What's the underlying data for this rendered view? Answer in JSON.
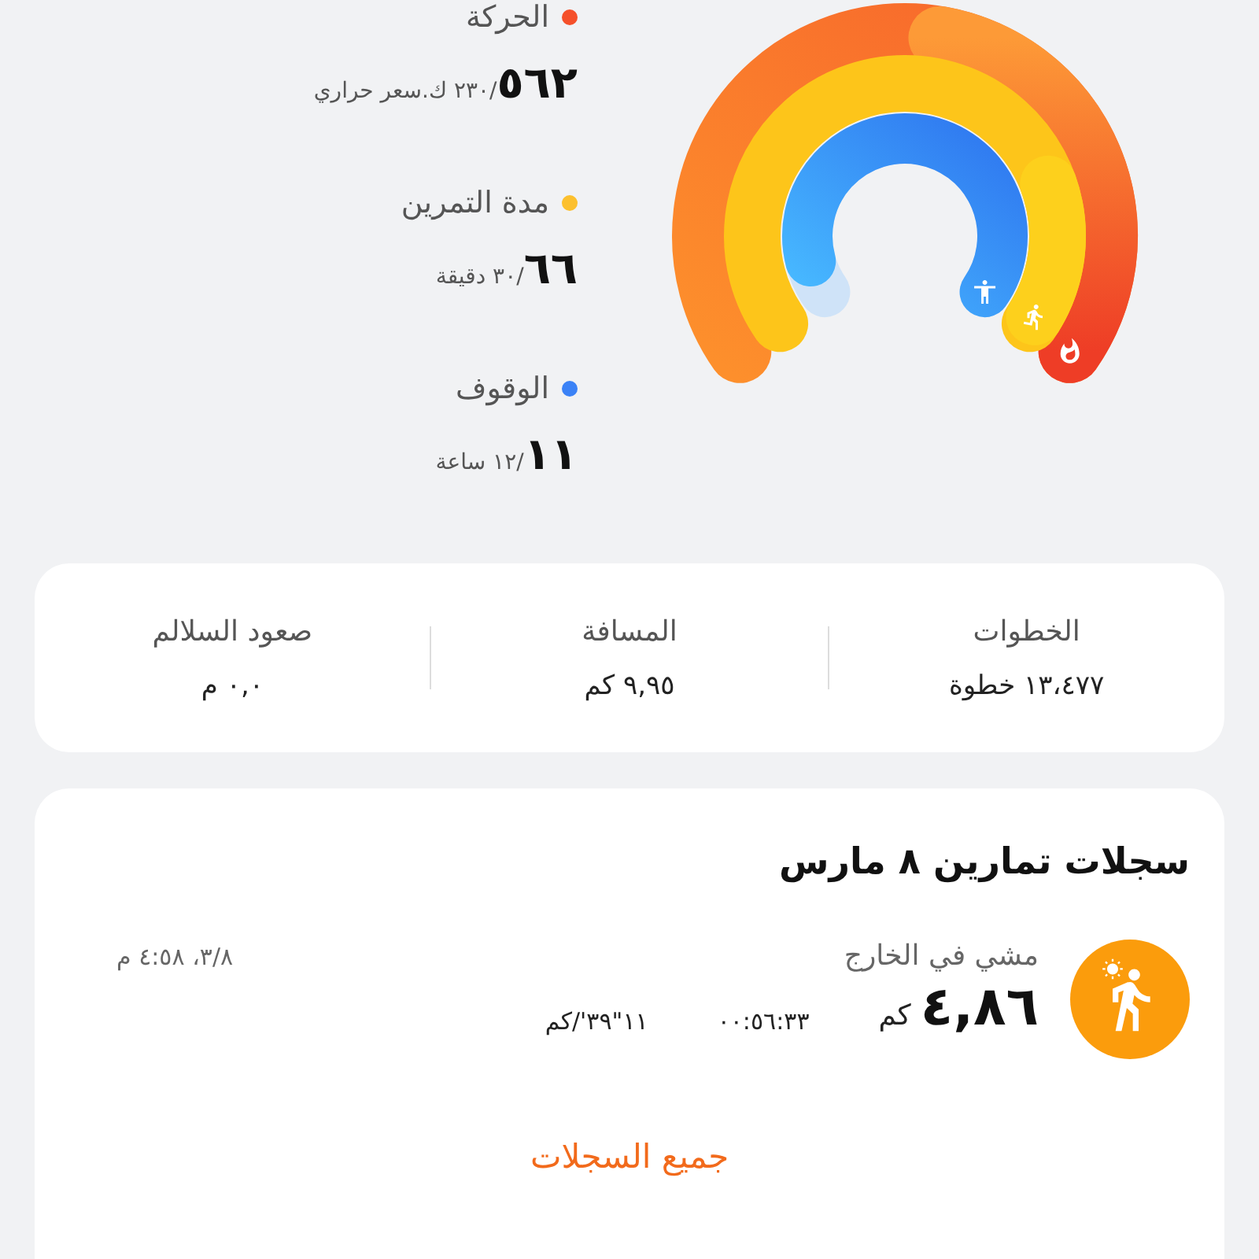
{
  "activity": [
    {
      "label": "الحركة",
      "color": "#f5502a",
      "value": "٥٦٢",
      "goal": "/٢٣٠ ك.سعر حراري"
    },
    {
      "label": "مدة التمرين",
      "color": "#fcc02e",
      "value": "٦٦",
      "goal": "/٣٠ دقيقة"
    },
    {
      "label": "الوقوف",
      "color": "#3b82f6",
      "value": "١١",
      "goal": "/١٢ ساعة"
    }
  ],
  "stats": [
    {
      "label": "الخطوات",
      "value": "١٣،٤٧٧ خطوة"
    },
    {
      "label": "المسافة",
      "value": "٩,٩٥ كم"
    },
    {
      "label": "صعود السلالم",
      "value": "٠,٠ م"
    }
  ],
  "records": {
    "title": "سجلات تمارين ٨ مارس",
    "items": [
      {
        "name": "مشي في الخارج",
        "time": "٣/٨، ٤:٥٨ م",
        "distance": "٤,٨٦",
        "unit": "كم",
        "duration": "٠٠:٥٦:٣٣",
        "pace": "١١\"٣٩'/كم"
      }
    ],
    "all_link": "جميع السجلات"
  }
}
